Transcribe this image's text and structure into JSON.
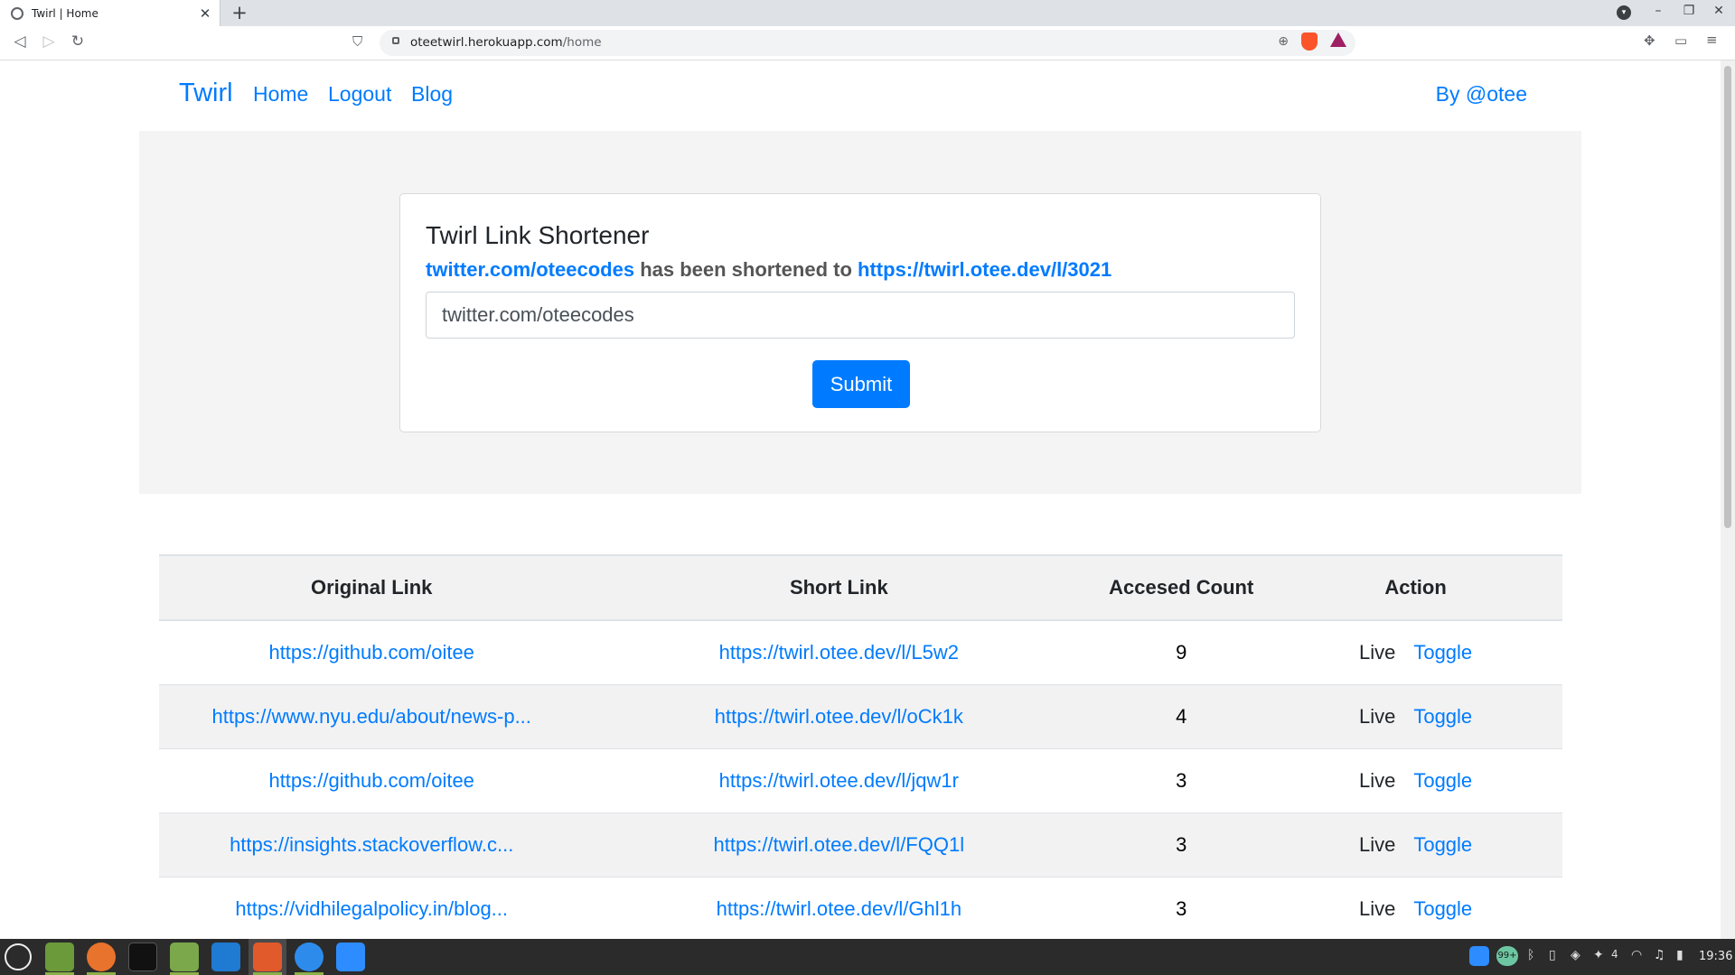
{
  "browser": {
    "tab_title": "Twirl | Home",
    "tab_close": "✕",
    "new_tab": "+",
    "url_host": "oteetwirl.herokuapp.com",
    "url_path": "/home"
  },
  "navbar": {
    "brand": "Twirl",
    "links": [
      "Home",
      "Logout",
      "Blog"
    ],
    "byline": "By @otee"
  },
  "card": {
    "title": "Twirl Link Shortener",
    "original_link": "twitter.com/oteecodes",
    "shortened_text": "has been shortened to",
    "short_link": "https://twirl.otee.dev/l/3021",
    "input_value": "twitter.com/oteecodes",
    "submit_label": "Submit"
  },
  "table": {
    "headers": [
      "Original Link",
      "Short Link",
      "Accesed Count",
      "Action"
    ],
    "rows": [
      {
        "original": "https://github.com/oitee",
        "short": "https://twirl.otee.dev/l/L5w2",
        "count": "9",
        "status": "Live",
        "action": "Toggle"
      },
      {
        "original": "https://www.nyu.edu/about/news-p...",
        "short": "https://twirl.otee.dev/l/oCk1k",
        "count": "4",
        "status": "Live",
        "action": "Toggle"
      },
      {
        "original": "https://github.com/oitee",
        "short": "https://twirl.otee.dev/l/jqw1r",
        "count": "3",
        "status": "Live",
        "action": "Toggle"
      },
      {
        "original": "https://insights.stackoverflow.c...",
        "short": "https://twirl.otee.dev/l/FQQ1l",
        "count": "3",
        "status": "Live",
        "action": "Toggle"
      },
      {
        "original": "https://vidhilegalpolicy.in/blog...",
        "short": "https://twirl.otee.dev/l/Ghl1h",
        "count": "3",
        "status": "Live",
        "action": "Toggle"
      }
    ]
  },
  "taskbar": {
    "badge": "99+",
    "notif_count": "4",
    "clock": "19:36"
  },
  "colors": {
    "link": "#007bff",
    "jumbotron_bg": "#f4f4f4",
    "taskbar_bg": "#2b2b2b"
  },
  "icons": [
    "menu-icon",
    "files-icon",
    "firefox-icon",
    "terminal-icon",
    "folder-icon",
    "vscode-icon",
    "brave-icon",
    "zotero-icon",
    "zoom-icon"
  ]
}
